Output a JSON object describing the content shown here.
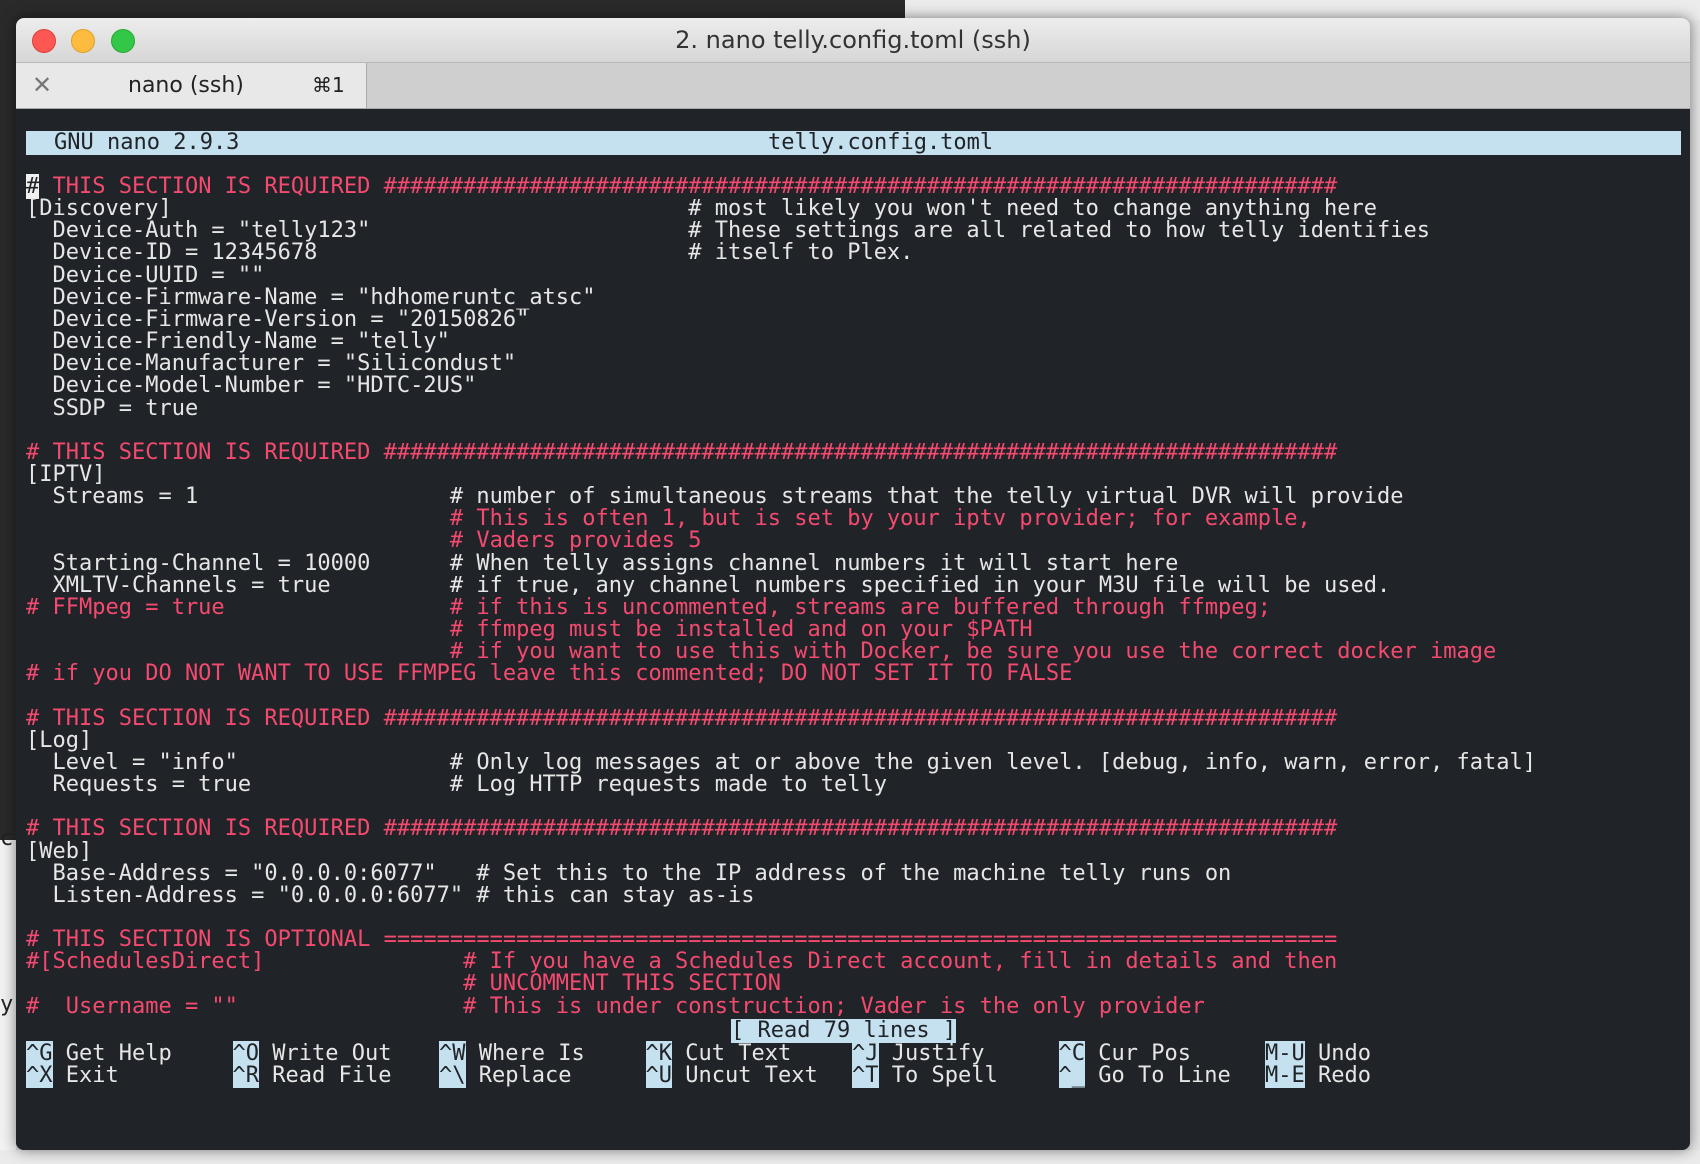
{
  "window": {
    "title": "2. nano telly.config.toml (ssh)",
    "tab_label": "nano (ssh)",
    "tab_shortcut": "⌘1",
    "tab_close": "✕"
  },
  "stray_text": [
    "c",
    "y"
  ],
  "nano": {
    "version": "GNU nano 2.9.3",
    "filename": "telly.config.toml",
    "status": "[ Read 79 lines ]"
  },
  "lines": [
    {
      "parts": [
        {
          "t": "#",
          "c": "cursor"
        },
        {
          "t": " THIS SECTION IS REQUIRED ########################################################################",
          "c": "red"
        }
      ]
    },
    {
      "parts": [
        {
          "t": "[Discovery]                                       # most likely you won't need to change anything here",
          "c": ""
        }
      ]
    },
    {
      "parts": [
        {
          "t": "  Device-Auth = \"telly123\"                        # These settings are all related to how telly identifies",
          "c": ""
        }
      ]
    },
    {
      "parts": [
        {
          "t": "  Device-ID = 12345678                            # itself to Plex.",
          "c": ""
        }
      ]
    },
    {
      "parts": [
        {
          "t": "  Device-UUID = \"\"",
          "c": ""
        }
      ]
    },
    {
      "parts": [
        {
          "t": "  Device-Firmware-Name = \"hdhomeruntc_atsc\"",
          "c": ""
        }
      ]
    },
    {
      "parts": [
        {
          "t": "  Device-Firmware-Version = \"20150826\"",
          "c": ""
        }
      ]
    },
    {
      "parts": [
        {
          "t": "  Device-Friendly-Name = \"telly\"",
          "c": ""
        }
      ]
    },
    {
      "parts": [
        {
          "t": "  Device-Manufacturer = \"Silicondust\"",
          "c": ""
        }
      ]
    },
    {
      "parts": [
        {
          "t": "  Device-Model-Number = \"HDTC-2US\"",
          "c": ""
        }
      ]
    },
    {
      "parts": [
        {
          "t": "  SSDP = true",
          "c": ""
        }
      ]
    },
    {
      "parts": [
        {
          "t": "",
          "c": ""
        }
      ]
    },
    {
      "parts": [
        {
          "t": "# THIS SECTION IS REQUIRED ########################################################################",
          "c": "red"
        }
      ]
    },
    {
      "parts": [
        {
          "t": "[IPTV]",
          "c": ""
        }
      ]
    },
    {
      "parts": [
        {
          "t": "  Streams = 1                   # number of simultaneous streams that the telly virtual DVR will provide",
          "c": ""
        }
      ]
    },
    {
      "parts": [
        {
          "t": "                                ",
          "c": ""
        },
        {
          "t": "# This is often 1, but is set by your iptv provider; for example,",
          "c": "red"
        }
      ]
    },
    {
      "parts": [
        {
          "t": "                                ",
          "c": ""
        },
        {
          "t": "# Vaders provides 5",
          "c": "red"
        }
      ]
    },
    {
      "parts": [
        {
          "t": "  Starting-Channel = 10000      # When telly assigns channel numbers it will start here",
          "c": ""
        }
      ]
    },
    {
      "parts": [
        {
          "t": "  XMLTV-Channels = true         # if true, any channel numbers specified in your M3U file will be used.",
          "c": ""
        }
      ]
    },
    {
      "parts": [
        {
          "t": "# FFMpeg = true                 # if this is uncommented, streams are buffered through ffmpeg;",
          "c": "red"
        }
      ]
    },
    {
      "parts": [
        {
          "t": "                                ",
          "c": ""
        },
        {
          "t": "# ffmpeg must be installed and on your $PATH",
          "c": "red"
        }
      ]
    },
    {
      "parts": [
        {
          "t": "                                ",
          "c": ""
        },
        {
          "t": "# if you want to use this with Docker, be sure you use the correct docker image",
          "c": "red"
        }
      ]
    },
    {
      "parts": [
        {
          "t": "# if you DO NOT WANT TO USE FFMPEG leave this commented; DO NOT SET IT TO FALSE",
          "c": "red"
        }
      ]
    },
    {
      "parts": [
        {
          "t": "",
          "c": ""
        }
      ]
    },
    {
      "parts": [
        {
          "t": "# THIS SECTION IS REQUIRED ########################################################################",
          "c": "red"
        }
      ]
    },
    {
      "parts": [
        {
          "t": "[Log]",
          "c": ""
        }
      ]
    },
    {
      "parts": [
        {
          "t": "  Level = \"info\"                # Only log messages at or above the given level. [debug, info, warn, error, fatal]",
          "c": ""
        }
      ]
    },
    {
      "parts": [
        {
          "t": "  Requests = true               # Log HTTP requests made to telly",
          "c": ""
        }
      ]
    },
    {
      "parts": [
        {
          "t": "",
          "c": ""
        }
      ]
    },
    {
      "parts": [
        {
          "t": "# THIS SECTION IS REQUIRED ########################################################################",
          "c": "red"
        }
      ]
    },
    {
      "parts": [
        {
          "t": "[Web]",
          "c": ""
        }
      ]
    },
    {
      "parts": [
        {
          "t": "  Base-Address = \"0.0.0.0:6077\"   # Set this to the IP address of the machine telly runs on",
          "c": ""
        }
      ]
    },
    {
      "parts": [
        {
          "t": "  Listen-Address = \"0.0.0.0:6077\" # this can stay as-is",
          "c": ""
        }
      ]
    },
    {
      "parts": [
        {
          "t": "",
          "c": ""
        }
      ]
    },
    {
      "parts": [
        {
          "t": "# THIS SECTION IS OPTIONAL ========================================================================",
          "c": "red"
        }
      ]
    },
    {
      "parts": [
        {
          "t": "#[SchedulesDirect]               # If you have a Schedules Direct account, fill in details and then",
          "c": "red"
        }
      ]
    },
    {
      "parts": [
        {
          "t": "                                 # UNCOMMENT THIS SECTION",
          "c": "red"
        }
      ]
    },
    {
      "parts": [
        {
          "t": "#  Username = \"\"                 # This is under construction; Vader is the only provider",
          "c": "red"
        }
      ]
    }
  ],
  "shortcuts": [
    {
      "key": "^G",
      "label": "Get Help"
    },
    {
      "key": "^O",
      "label": "Write Out"
    },
    {
      "key": "^W",
      "label": "Where Is"
    },
    {
      "key": "^K",
      "label": "Cut Text"
    },
    {
      "key": "^J",
      "label": "Justify"
    },
    {
      "key": "^C",
      "label": "Cur Pos"
    },
    {
      "key": "M-U",
      "label": "Undo"
    },
    {
      "key": "^X",
      "label": "Exit"
    },
    {
      "key": "^R",
      "label": "Read File"
    },
    {
      "key": "^\\",
      "label": "Replace"
    },
    {
      "key": "^U",
      "label": "Uncut Text"
    },
    {
      "key": "^T",
      "label": "To Spell"
    },
    {
      "key": "^_",
      "label": "Go To Line"
    },
    {
      "key": "M-E",
      "label": "Redo"
    }
  ]
}
